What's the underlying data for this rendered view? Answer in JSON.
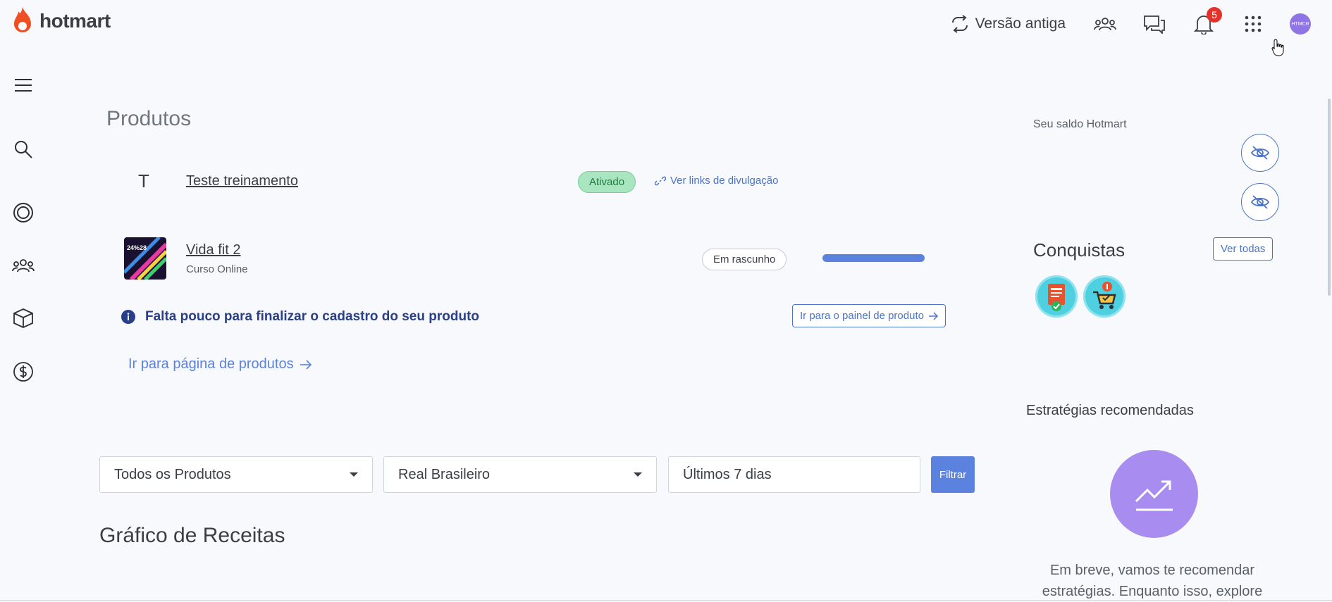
{
  "header": {
    "logo_text": "hotmart",
    "old_version_label": "Versão antiga",
    "notifications_count": "5",
    "avatar_text": "HTMCR"
  },
  "products_section": {
    "title": "Produtos",
    "products": [
      {
        "initial": "T",
        "name": "Teste treinamento",
        "status": "Ativado",
        "link_label": "Ver links de divulgação"
      },
      {
        "name": "Vida fit 2",
        "type": "Curso Online",
        "status": "Em rascunho",
        "thumb_text": "24%28"
      }
    ],
    "notice_text": "Falta pouco para finalizar o cadastro do seu produto",
    "notice_button": "Ir para o painel de produto",
    "goto_products_label": "Ir para página de produtos"
  },
  "filters": {
    "product_select": "Todos os Produtos",
    "currency_select": "Real Brasileiro",
    "period_select": "Últimos 7 dias",
    "filter_button": "Filtrar"
  },
  "chart_section": {
    "title": "Gráfico de Receitas"
  },
  "right_panel": {
    "balance_label": "Seu saldo Hotmart",
    "achievements_title": "Conquistas",
    "view_all_button": "Ver todas",
    "strategies_title": "Estratégias recomendadas",
    "strategies_text": "Em breve, vamos te recomendar estratégias. Enquanto isso, explore"
  },
  "colors": {
    "brand_orange": "#f04e23",
    "link_blue": "#4b74c9",
    "primary_blue": "#5b82df",
    "active_green": "#a9e6bf",
    "strategy_purple": "#a98cf0"
  }
}
